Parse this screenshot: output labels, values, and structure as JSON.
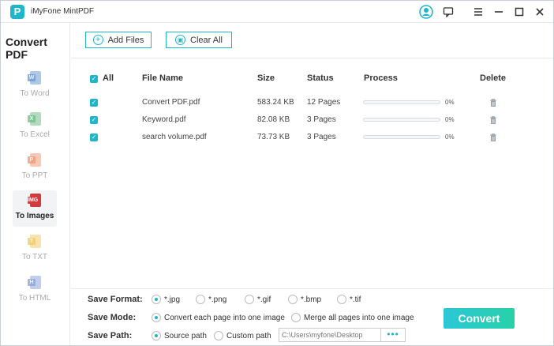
{
  "app": {
    "title": "iMyFone MintPDF",
    "logo_letter": "P"
  },
  "titlebar_icons": [
    "user-icon",
    "feedback-icon",
    "menu-icon",
    "minimize-icon",
    "maximize-icon",
    "close-icon"
  ],
  "sidebar": {
    "title": "Convert PDF",
    "items": [
      {
        "label": "To Word",
        "tag": "W",
        "color": "#6d9bd6",
        "active": false
      },
      {
        "label": "To Excel",
        "tag": "X",
        "color": "#74c08a",
        "active": false
      },
      {
        "label": "To PPT",
        "tag": "P",
        "color": "#ef9a7a",
        "active": false
      },
      {
        "label": "To Images",
        "tag": "IMG",
        "color": "#d23b3b",
        "active": true
      },
      {
        "label": "To TXT",
        "tag": "T",
        "color": "#f1cc6b",
        "active": false
      },
      {
        "label": "To HTML",
        "tag": "H",
        "color": "#8fa6d8",
        "active": false
      }
    ]
  },
  "toolbar": {
    "add_files": "Add Files",
    "clear_all": "Clear All"
  },
  "table": {
    "headers": {
      "all": "All",
      "file_name": "File Name",
      "size": "Size",
      "status": "Status",
      "process": "Process",
      "delete": "Delete"
    },
    "rows": [
      {
        "name": "Convert PDF.pdf",
        "size": "583.24 KB",
        "status": "12 Pages",
        "progress": 0,
        "pct": "0%"
      },
      {
        "name": "Keyword.pdf",
        "size": "82.08 KB",
        "status": "3 Pages",
        "progress": 0,
        "pct": "0%"
      },
      {
        "name": "search volume.pdf",
        "size": "73.73 KB",
        "status": "3 Pages",
        "progress": 0,
        "pct": "0%"
      }
    ]
  },
  "settings": {
    "format_label": "Save Format:",
    "formats": [
      {
        "label": "*.jpg",
        "selected": true
      },
      {
        "label": "*.png",
        "selected": false
      },
      {
        "label": "*.gif",
        "selected": false
      },
      {
        "label": "*.bmp",
        "selected": false
      },
      {
        "label": "*.tif",
        "selected": false
      }
    ],
    "mode_label": "Save Mode:",
    "modes": [
      {
        "label": "Convert each page into one image",
        "selected": true
      },
      {
        "label": "Merge all pages into one image",
        "selected": false
      }
    ],
    "path_label": "Save Path:",
    "paths": [
      {
        "label": "Source path",
        "selected": true
      },
      {
        "label": "Custom path",
        "selected": false
      }
    ],
    "path_value": "C:\\Users\\myfone\\Desktop",
    "browse": "•••",
    "convert": "Convert"
  },
  "colors": {
    "accent": "#1fb6c9"
  }
}
